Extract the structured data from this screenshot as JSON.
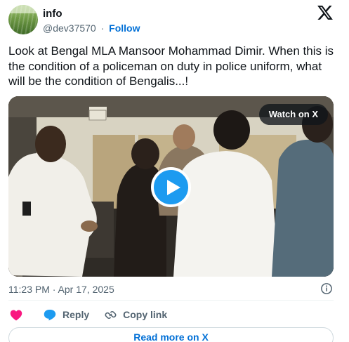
{
  "author": {
    "name": "info",
    "handle": "@dev37570",
    "separator": "·",
    "follow_label": "Follow"
  },
  "tweet": {
    "text": "Look at Bengal MLA Mansoor Mohammad Dimir. When this is the condition of a policeman on duty in police uniform, what will be the condition of Bengalis...!"
  },
  "media": {
    "watch_label": "Watch on X",
    "play_icon": "play-icon",
    "brand_color": "#1d9bf0"
  },
  "meta": {
    "timestamp": "11:23 PM · Apr 17, 2025"
  },
  "actions": {
    "like_icon": "heart-icon",
    "reply_label": "Reply",
    "copy_label": "Copy link"
  },
  "footer": {
    "read_more_label": "Read more on X"
  },
  "colors": {
    "link": "#006fd6",
    "heart": "#f91880",
    "reply_icon": "#1d9bf0",
    "muted": "#536471"
  }
}
